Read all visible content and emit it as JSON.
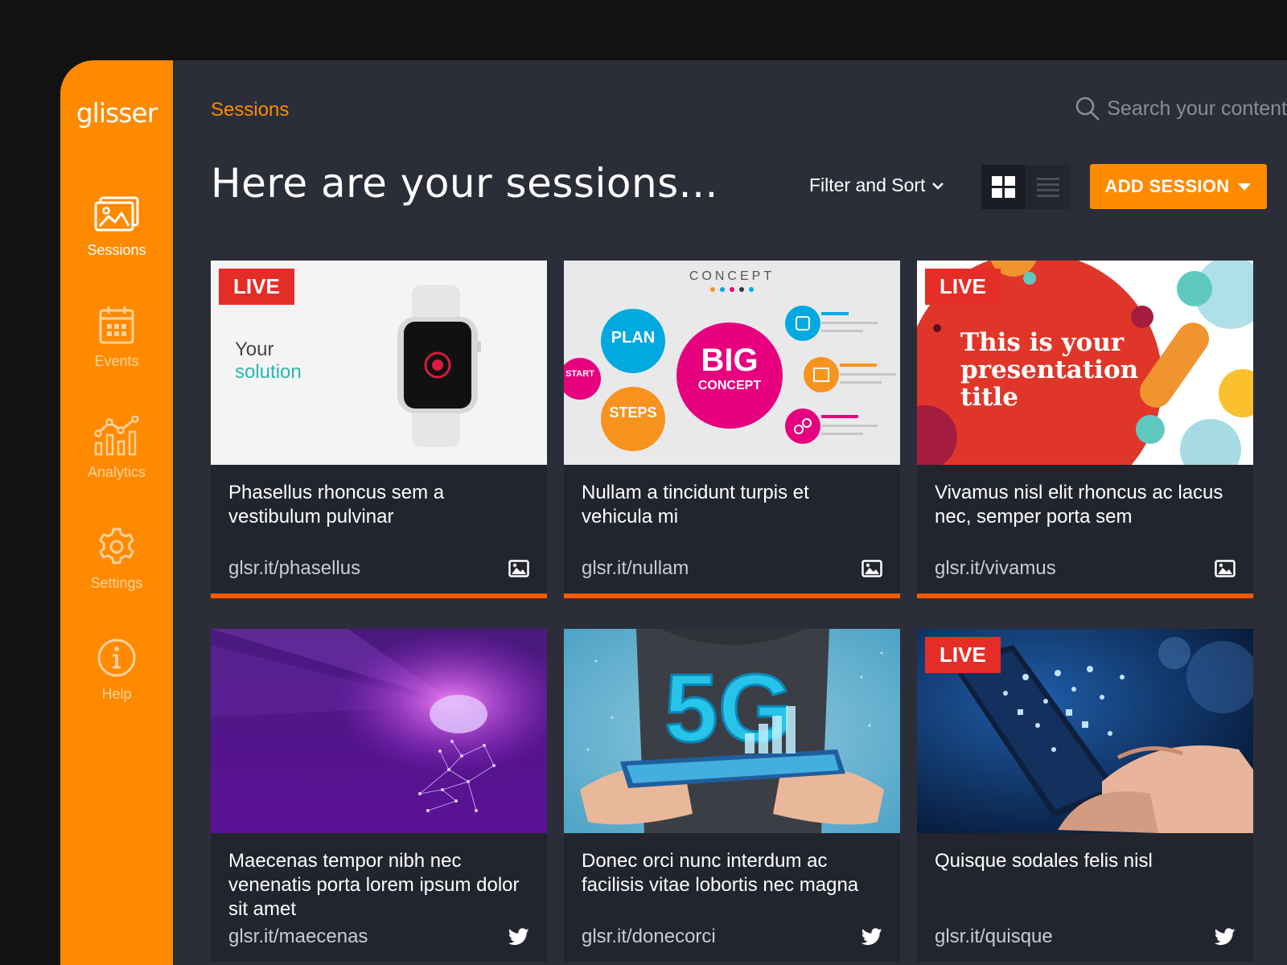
{
  "brand": {
    "logo": "glisser",
    "accent": "#ff8a00"
  },
  "sidebar": {
    "items": [
      {
        "label": "Sessions",
        "icon": "image-gallery-icon",
        "active": true
      },
      {
        "label": "Events",
        "icon": "calendar-icon",
        "active": false
      },
      {
        "label": "Analytics",
        "icon": "analytics-chart-icon",
        "active": false
      },
      {
        "label": "Settings",
        "icon": "gear-icon",
        "active": false
      },
      {
        "label": "Help",
        "icon": "info-icon",
        "active": false
      }
    ]
  },
  "header": {
    "breadcrumb": "Sessions",
    "search_placeholder": "Search your content"
  },
  "toolbar": {
    "heading": "Here are your sessions...",
    "filter_label": "Filter and Sort",
    "add_label": "ADD SESSION",
    "view": "grid"
  },
  "sessions": [
    {
      "title": "Phasellus rhoncus sem a vestibulum pulvinar",
      "link": "glsr.it/phasellus",
      "live": true,
      "live_label": "LIVE",
      "source": "image-icon",
      "thumb_text_1": "Your",
      "thumb_text_2": "solution"
    },
    {
      "title": "Nullam a tincidunt turpis et vehicula mi",
      "link": "glsr.it/nullam",
      "live": false,
      "source": "image-icon",
      "thumb_heading": "CONCEPT",
      "thumb_big_1": "BIG",
      "thumb_big_2": "CONCEPT",
      "thumb_plan": "PLAN",
      "thumb_steps": "STEPS",
      "thumb_start": "START"
    },
    {
      "title": "Vivamus nisl elit rhoncus ac lacus nec, semper porta sem",
      "link": "glsr.it/vivamus",
      "live": true,
      "live_label": "LIVE",
      "source": "image-icon",
      "thumb_text_1": "This is your",
      "thumb_text_2": "presentation",
      "thumb_text_3": "title"
    },
    {
      "title": "Maecenas tempor nibh nec venenatis porta lorem ipsum dolor sit amet",
      "link": "glsr.it/maecenas",
      "live": false,
      "source": "twitter-icon"
    },
    {
      "title": "Donec orci nunc interdum ac facilisis vitae lobortis nec magna",
      "link": "glsr.it/donecorci",
      "live": false,
      "source": "twitter-icon",
      "thumb_text_1": "5G"
    },
    {
      "title": "Quisque sodales felis nisl",
      "link": "glsr.it/quisque",
      "live": true,
      "live_label": "LIVE",
      "source": "twitter-icon"
    }
  ]
}
